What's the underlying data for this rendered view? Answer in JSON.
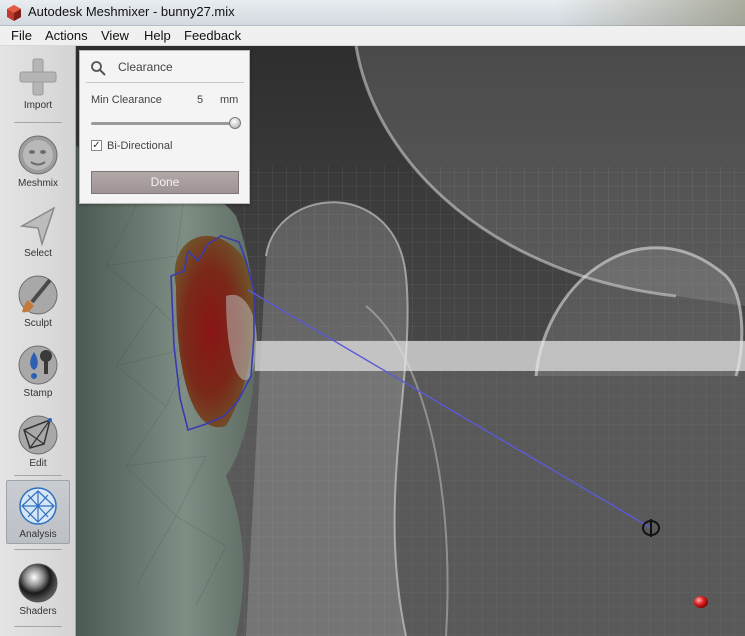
{
  "window": {
    "title": "Autodesk Meshmixer - bunny27.mix"
  },
  "menu": {
    "file": "File",
    "actions": "Actions",
    "view": "View",
    "help": "Help",
    "feedback": "Feedback"
  },
  "toolbar": {
    "import": "Import",
    "meshmix": "Meshmix",
    "select": "Select",
    "sculpt": "Sculpt",
    "stamp": "Stamp",
    "edit": "Edit",
    "analysis": "Analysis",
    "shaders": "Shaders",
    "active_tool": "analysis"
  },
  "panel": {
    "title": "Clearance",
    "min_clearance_label": "Min Clearance",
    "min_clearance_value": "5",
    "min_clearance_unit": "mm",
    "slider_fraction": 1.0,
    "bidirectional_label": "Bi-Directional",
    "bidirectional_checked": true,
    "done_label": "Done"
  },
  "colors": {
    "accent_line": "#5a5ad8",
    "highlight_red": "#8c1c16",
    "button_bg": "#a89e9e"
  }
}
